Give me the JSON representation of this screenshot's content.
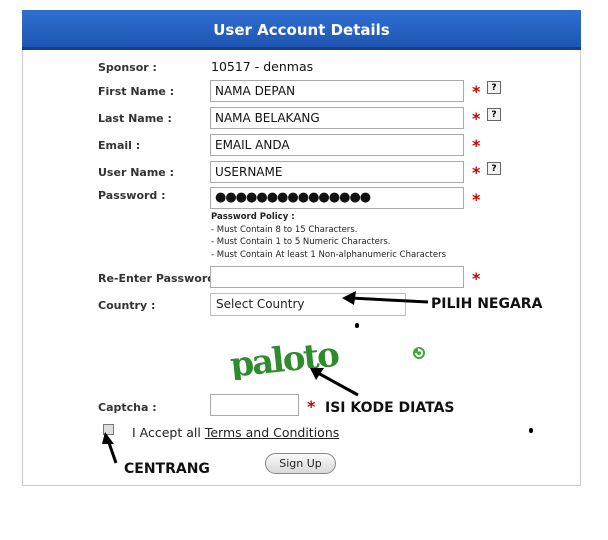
{
  "header": {
    "title": "User Account Details"
  },
  "form": {
    "sponsor_label": "Sponsor :",
    "sponsor_value": "10517 - denmas",
    "first_name_label": "First Name :",
    "first_name_value": "NAMA DEPAN",
    "last_name_label": "Last Name :",
    "last_name_value": "NAMA BELAKANG",
    "email_label": "Email :",
    "email_value": "EMAIL ANDA",
    "username_label": "User Name :",
    "username_value": "USERNAME",
    "password_label": "Password :",
    "password_value": "●●●●●●●●●●●●●●●",
    "policy_title": "Password Policy :",
    "policy_1": "- Must Contain 8 to 15 Characters.",
    "policy_2": "- Must Contain 1 to 5 Numeric Characters.",
    "policy_3": "- Must Contain At least 1 Non-alphanumeric Characters",
    "reenter_label": "Re-Enter Password :",
    "reenter_value": "",
    "country_label": "Country :",
    "country_value": "Select Country",
    "captcha_text": "paloto",
    "captcha_label": "Captcha :",
    "captcha_value": "",
    "required_mark": "*",
    "help_mark": "?",
    "accept_text": "I Accept all",
    "terms_link": "Terms and Conditions",
    "signup_label": "Sign Up"
  },
  "annotations": {
    "country": "PILIH NEGARA",
    "captcha": "ISI KODE DIATAS",
    "checkbox": "CENTRANG"
  },
  "colors": {
    "header": "#1f56b3",
    "required": "#d00000",
    "captcha": "#2e8b2e"
  }
}
